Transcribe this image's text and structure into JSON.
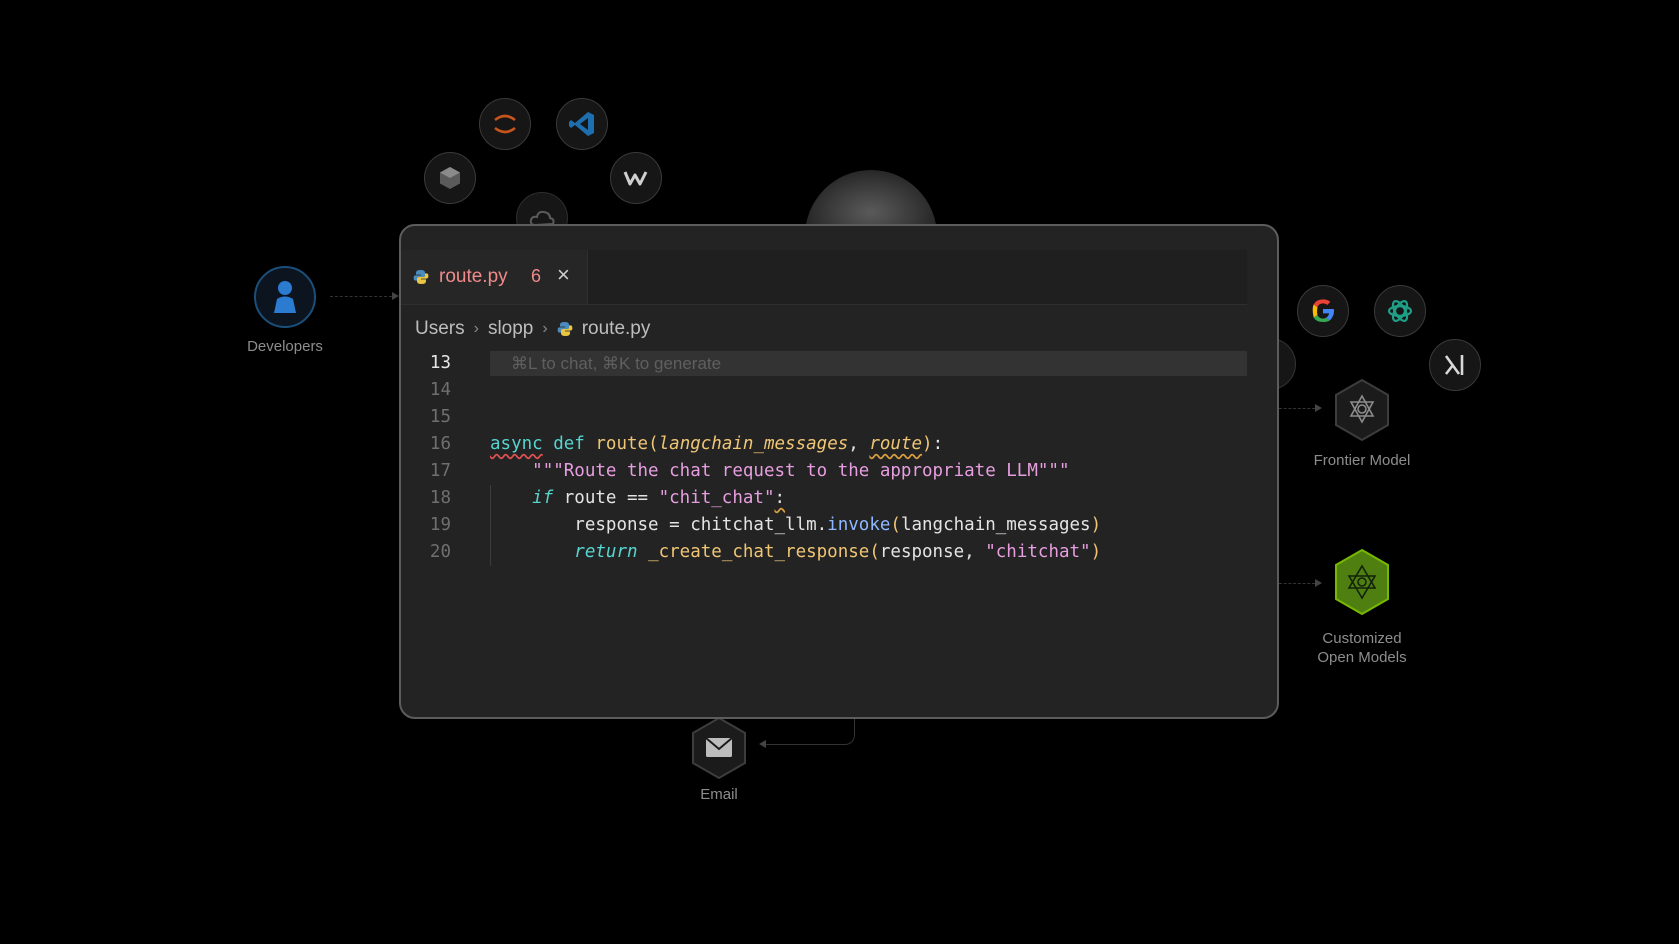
{
  "background": {
    "developers_label": "Developers",
    "frontier_label": "Frontier Model",
    "customized_label_1": "Customized",
    "customized_label_2": "Open Models",
    "email_label": "Email"
  },
  "editor": {
    "tab": {
      "filename": "route.py",
      "problem_count": "6",
      "close_glyph": "×"
    },
    "breadcrumb": [
      "Users",
      "slopp",
      "route.py"
    ],
    "hint": "⌘L to chat, ⌘K to generate",
    "line_numbers": [
      "13",
      "14",
      "15",
      "16",
      "17",
      "18",
      "19",
      "20"
    ],
    "code": {
      "l16": {
        "async": "async",
        "def": "def",
        "fn": "route",
        "open": "(",
        "p1": "langchain_messages",
        "comma": ", ",
        "p2": "route",
        "close": ")",
        "colon": ":"
      },
      "l17": {
        "indent": "    ",
        "doc": "\"\"\"Route the chat request to the appropriate LLM\"\"\""
      },
      "l18": {
        "indent": "    ",
        "kw": "if",
        "mid": " route == ",
        "str": "\"chit_chat\"",
        "colon": ":"
      },
      "l19": {
        "indent": "        ",
        "lhs": "response = chitchat_llm.",
        "method": "invoke",
        "open": "(",
        "arg": "langchain_messages",
        "close": ")"
      },
      "l20": {
        "indent": "        ",
        "kw": "return",
        "sp": " ",
        "fn": "_create_chat_response",
        "open": "(",
        "arg": "response, ",
        "str": "\"chitchat\"",
        "close": ")"
      }
    }
  },
  "colors": {
    "background": "#000000",
    "editor_bg": "#232323",
    "tab_error_text": "#f08a8a",
    "keyword": "#56d4d0",
    "function": "#f0c674",
    "string": "#e79ee0",
    "method": "#8fb8ff",
    "nvidia_green": "#76b900"
  }
}
